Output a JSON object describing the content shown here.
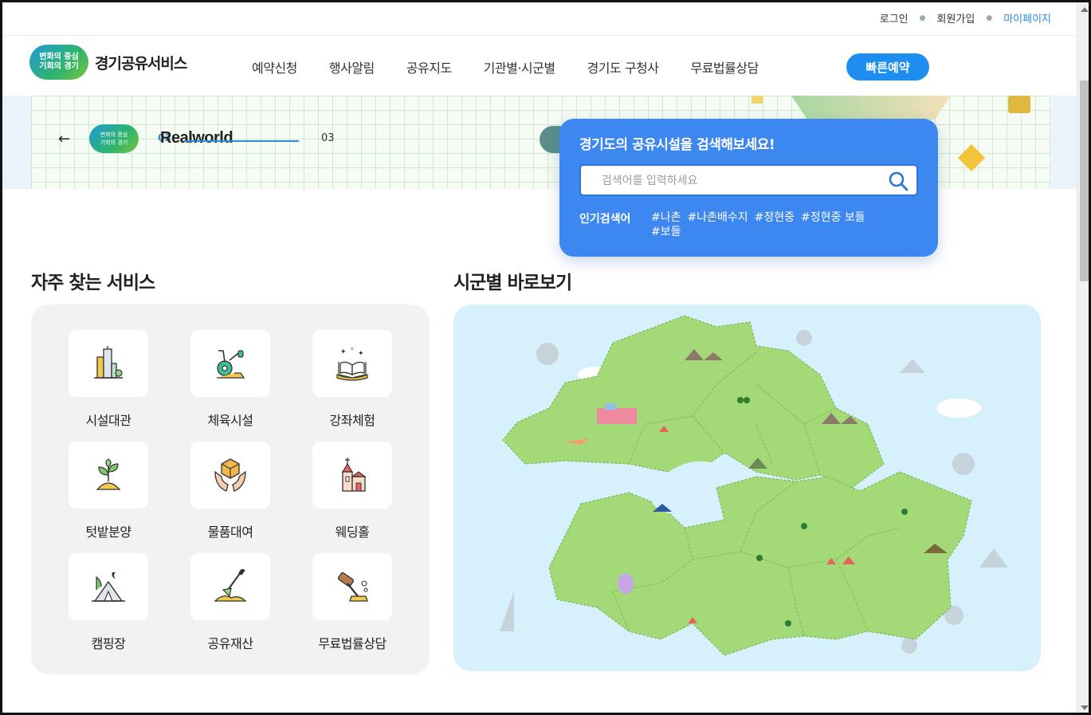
{
  "util": {
    "login": "로그인",
    "signup": "회원가입",
    "mypage": "마이페이지"
  },
  "logo": {
    "badge_line1": "변화의 중심",
    "badge_line2": "기회의 경기",
    "title": "경기공유서비스"
  },
  "gnb": {
    "items": [
      "예약신청",
      "행사알림",
      "공유지도",
      "기관별·시군별",
      "경기도 구청사",
      "무료법률상담"
    ],
    "quick_button": "빠른예약"
  },
  "banner": {
    "current": "03",
    "total": "03",
    "brand": "Realworld",
    "mini_line1": "변화의 중심",
    "mini_line2": "기회의 경기"
  },
  "search": {
    "title": "경기도의 공유시설을 검색해보세요!",
    "placeholder": "검색어를 입력하세요",
    "popular_label": "인기검색어",
    "popular_tags": [
      "#나촌",
      "#나촌배수지",
      "#정현중",
      "#정현중 보들",
      "#보들"
    ]
  },
  "services": {
    "title": "자주 찾는 서비스",
    "items": [
      {
        "label": "시설대관",
        "icon": "building-icon"
      },
      {
        "label": "체육시설",
        "icon": "exercise-bike-icon"
      },
      {
        "label": "강좌체험",
        "icon": "open-book-icon"
      },
      {
        "label": "텃밭분양",
        "icon": "sprout-icon"
      },
      {
        "label": "물품대여",
        "icon": "box-hands-icon"
      },
      {
        "label": "웨딩홀",
        "icon": "chapel-icon"
      },
      {
        "label": "캠핑장",
        "icon": "camping-tent-icon"
      },
      {
        "label": "공유재산",
        "icon": "shovel-icon"
      },
      {
        "label": "무료법률상담",
        "icon": "gavel-icon"
      }
    ]
  },
  "map": {
    "title": "시군별 바로보기"
  },
  "colors": {
    "accent": "#1d8ef0",
    "search_card": "#3d87f0",
    "map_bg": "#d6f1fb",
    "map_land": "#a3d977"
  }
}
